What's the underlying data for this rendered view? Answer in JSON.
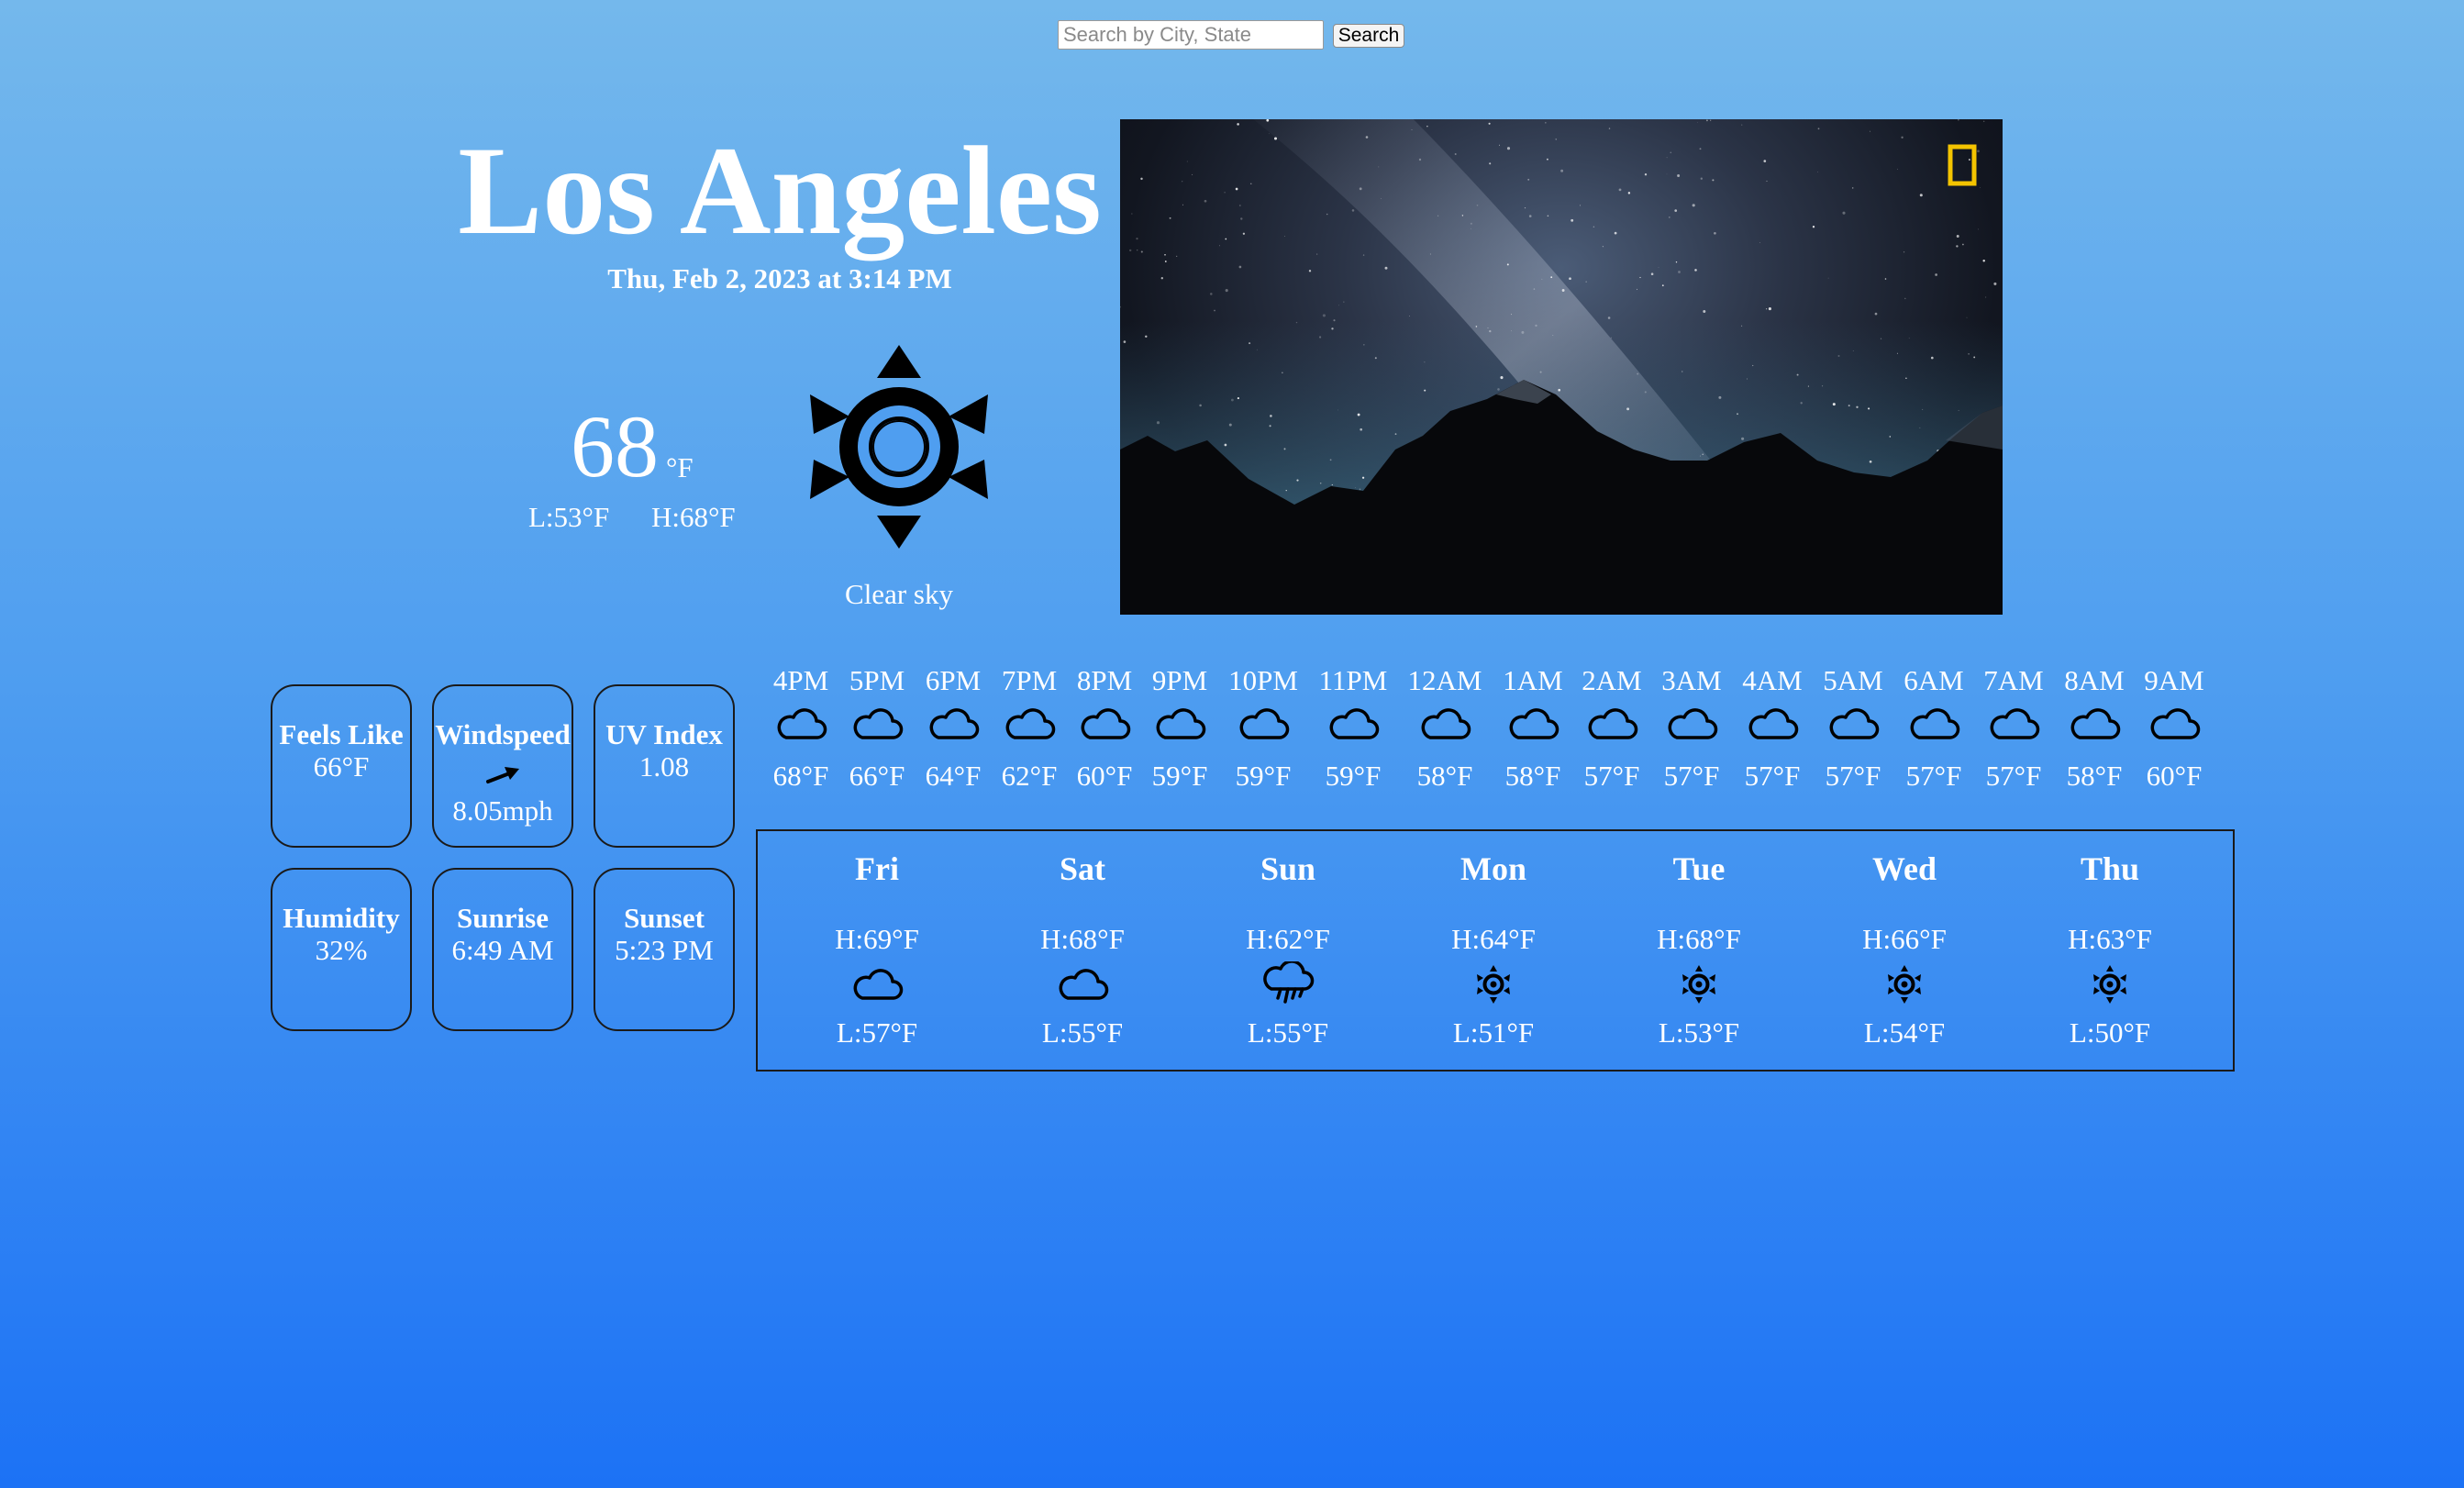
{
  "search": {
    "placeholder": "Search by City, State",
    "value": "",
    "button_label": "Search"
  },
  "location": {
    "city": "Los Angeles",
    "datetime": "Thu, Feb 2, 2023 at 3:14 PM"
  },
  "current": {
    "temp": "68",
    "unit": "°F",
    "low": "L:53°F",
    "high": "H:68°F",
    "icon": "sun-icon",
    "description": "Clear sky"
  },
  "photo": {
    "subject": "starry-night-mountains-photo",
    "badge_color": "#f4c400"
  },
  "stats": [
    {
      "title": "Feels Like",
      "value": "66°F"
    },
    {
      "title": "Windspeed",
      "value": "8.05mph",
      "icon": "wind-direction-arrow-icon"
    },
    {
      "title": "UV Index",
      "value": "1.08"
    },
    {
      "title": "Humidity",
      "value": "32%"
    },
    {
      "title": "Sunrise",
      "value": "6:49 AM"
    },
    {
      "title": "Sunset",
      "value": "5:23 PM"
    }
  ],
  "hourly": [
    {
      "time": "4PM",
      "icon": "cloud-icon",
      "temp": "68°F"
    },
    {
      "time": "5PM",
      "icon": "cloud-icon",
      "temp": "66°F"
    },
    {
      "time": "6PM",
      "icon": "cloud-icon",
      "temp": "64°F"
    },
    {
      "time": "7PM",
      "icon": "cloud-icon",
      "temp": "62°F"
    },
    {
      "time": "8PM",
      "icon": "cloud-icon",
      "temp": "60°F"
    },
    {
      "time": "9PM",
      "icon": "cloud-icon",
      "temp": "59°F"
    },
    {
      "time": "10PM",
      "icon": "cloud-icon",
      "temp": "59°F"
    },
    {
      "time": "11PM",
      "icon": "cloud-icon",
      "temp": "59°F"
    },
    {
      "time": "12AM",
      "icon": "cloud-icon",
      "temp": "58°F"
    },
    {
      "time": "1AM",
      "icon": "cloud-icon",
      "temp": "58°F"
    },
    {
      "time": "2AM",
      "icon": "cloud-icon",
      "temp": "57°F"
    },
    {
      "time": "3AM",
      "icon": "cloud-icon",
      "temp": "57°F"
    },
    {
      "time": "4AM",
      "icon": "cloud-icon",
      "temp": "57°F"
    },
    {
      "time": "5AM",
      "icon": "cloud-icon",
      "temp": "57°F"
    },
    {
      "time": "6AM",
      "icon": "cloud-icon",
      "temp": "57°F"
    },
    {
      "time": "7AM",
      "icon": "cloud-icon",
      "temp": "57°F"
    },
    {
      "time": "8AM",
      "icon": "cloud-icon",
      "temp": "58°F"
    },
    {
      "time": "9AM",
      "icon": "cloud-icon",
      "temp": "60°F"
    }
  ],
  "daily": [
    {
      "day": "Fri",
      "high": "H:69°F",
      "icon": "cloud-icon",
      "low": "L:57°F"
    },
    {
      "day": "Sat",
      "high": "H:68°F",
      "icon": "cloud-icon",
      "low": "L:55°F"
    },
    {
      "day": "Sun",
      "high": "H:62°F",
      "icon": "rain-cloud-icon",
      "low": "L:55°F"
    },
    {
      "day": "Mon",
      "high": "H:64°F",
      "icon": "sun-icon",
      "low": "L:51°F"
    },
    {
      "day": "Tue",
      "high": "H:68°F",
      "icon": "sun-icon",
      "low": "L:53°F"
    },
    {
      "day": "Wed",
      "high": "H:66°F",
      "icon": "sun-icon",
      "low": "L:54°F"
    },
    {
      "day": "Thu",
      "high": "H:63°F",
      "icon": "sun-icon",
      "low": "L:50°F"
    }
  ]
}
